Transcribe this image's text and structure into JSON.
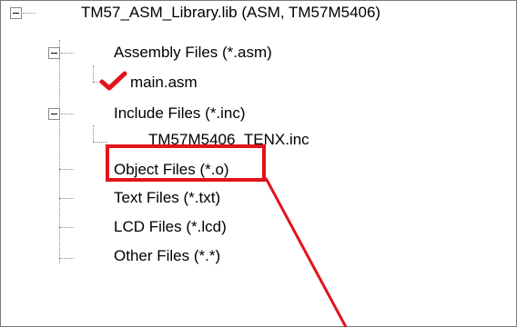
{
  "tree": {
    "root": {
      "label": "TM57_ASM_Library.lib (ASM, TM57M5406)",
      "expanded": true
    },
    "groups": [
      {
        "label": "Assembly Files (*.asm)",
        "expanded": true,
        "children": [
          {
            "label": "main.asm",
            "icon": "checkmark-icon"
          }
        ]
      },
      {
        "label": "Include Files (*.inc)",
        "expanded": true,
        "children": [
          {
            "label": "TM57M5406_TENX.inc"
          }
        ]
      },
      {
        "label": "Object Files (*.o)",
        "highlighted": true
      },
      {
        "label": "Text Files (*.txt)"
      },
      {
        "label": "LCD Files (*.lcd)"
      },
      {
        "label": "Other Files (*.*)"
      }
    ]
  },
  "colors": {
    "highlight": "#e3131b",
    "checkmark": "#e3131b",
    "border": "#7a7a7a"
  }
}
